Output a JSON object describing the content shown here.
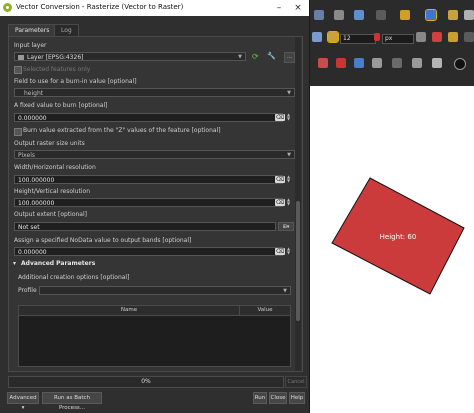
{
  "dialog": {
    "title": "Vector Conversion - Rasterize (Vector to Raster)",
    "tabs": [
      "Parameters",
      "Log"
    ]
  },
  "params": {
    "input_layer_label": "Input layer",
    "input_layer_value": "Layer [EPSG:4326]",
    "selected_only_label": "Selected features only",
    "burn_field_label": "Field to use for a burn-in value [optional]",
    "burn_field_value": "height",
    "fixed_value_label": "A fixed value to burn [optional]",
    "fixed_value": "0.000000",
    "burn_z_label": "Burn value extracted from the \"Z\" values of the feature [optional]",
    "units_label": "Output raster size units",
    "units_value": "Pixels",
    "width_label": "Width/Horizontal resolution",
    "width_value": "100.000000",
    "height_label": "Height/Vertical resolution",
    "height_value": "100.000000",
    "extent_label": "Output extent [optional]",
    "extent_value": "Not set",
    "nodata_label": "Assign a specified NoData value to output bands [optional]",
    "nodata_value": "0.000000",
    "advanced_label": "Advanced Parameters",
    "creation_label": "Additional creation options [optional]",
    "profile_label": "Profile",
    "profile_value": "",
    "table_headers": [
      "Name",
      "Value"
    ]
  },
  "footer": {
    "progress": "0%",
    "cancel": "Cancel",
    "advanced": "Advanced",
    "batch": "Run as Batch Process...",
    "run": "Run",
    "close": "Close",
    "help": "Help"
  },
  "map": {
    "scale": "12",
    "units": "px",
    "feature_label": "Height: 60",
    "feature_color": "#cc3b3b"
  },
  "colors": {
    "accent_green": "#93b023",
    "dialog_bg": "#2f2f2f"
  }
}
